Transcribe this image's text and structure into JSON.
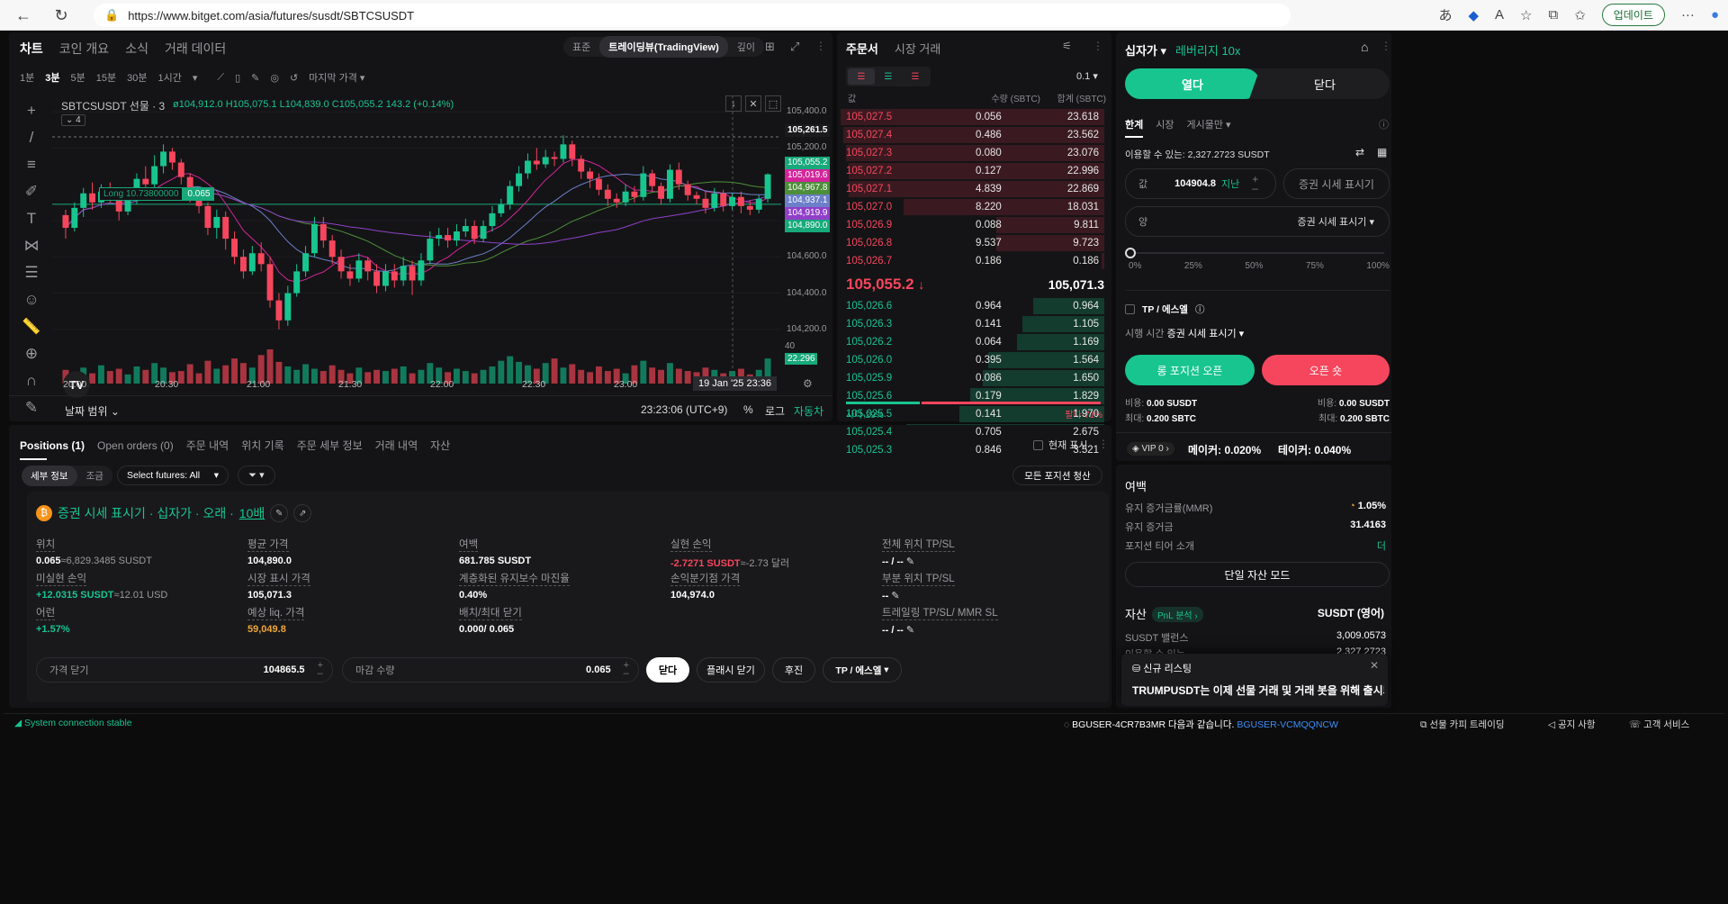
{
  "browser": {
    "url": "https://www.bitget.com/asia/futures/susdt/SBTCSUSDT",
    "update_label": "업데이트"
  },
  "chart_tabs": [
    "차트",
    "코인 개요",
    "소식",
    "거래 데이터"
  ],
  "view_modes": [
    "표준",
    "트레이딩뷰(TradingView)",
    "깊이"
  ],
  "intervals": [
    "1분",
    "3분",
    "5분",
    "15분",
    "30분",
    "1시간"
  ],
  "last_price_label": "마지막 가격",
  "chart_header": {
    "symbol": "SBTCSUSDT 선물 · 3",
    "ohlc": "ø104,912.0  H105,075.1  L104,839.0  C105,055.2  143.2 (+0.14%)",
    "indicator_count": "4"
  },
  "long_tag": {
    "label": "Long 10.73800000",
    "value": "0.065"
  },
  "price_axis": [
    "105,400.0",
    "105,200.0",
    "104,800.0",
    "104,600.0",
    "104,400.0",
    "104,200.0"
  ],
  "price_tags": [
    {
      "v": "105,261.5",
      "c": "#1b1b1d"
    },
    {
      "v": "105,055.2",
      "c": "#17a97a"
    },
    {
      "v": "105,019.6",
      "c": "#d3259b"
    },
    {
      "v": "104,967.8",
      "c": "#4d8e3a"
    },
    {
      "v": "104,937.1",
      "c": "#6c7fc9"
    },
    {
      "v": "104,919.9",
      "c": "#9040c8"
    },
    {
      "v": "104,890.0",
      "c": "#17a97a"
    }
  ],
  "volume_tags": {
    "top": "40",
    "value": "22.296"
  },
  "time_axis": [
    "20:00",
    "20:30",
    "21:00",
    "21:30",
    "22:00",
    "22:30",
    "23:00"
  ],
  "crosshair_time": "19 Jan '25  23:36",
  "chart_footer": {
    "range": "날짜 범위",
    "clock": "23:23:06 (UTC+9)",
    "pct": "%",
    "log": "로그",
    "auto": "자동차"
  },
  "chart_data": {
    "type": "candlestick",
    "title": "SBTCSUSDT 선물 · 3",
    "x_ticks": [
      "20:00",
      "20:30",
      "21:00",
      "21:30",
      "22:00",
      "22:30",
      "23:00"
    ],
    "ylim": [
      104100,
      105450
    ],
    "candles": [
      [
        104830,
        104760,
        104860,
        104700
      ],
      [
        104760,
        104870,
        104900,
        104740
      ],
      [
        104870,
        104950,
        104980,
        104820
      ],
      [
        104950,
        104900,
        105010,
        104860
      ],
      [
        104900,
        104960,
        105000,
        104870
      ],
      [
        104960,
        104940,
        105010,
        104900
      ],
      [
        104940,
        104850,
        104980,
        104800
      ],
      [
        104850,
        104920,
        104960,
        104830
      ],
      [
        104920,
        105030,
        105060,
        104890
      ],
      [
        105030,
        105000,
        105100,
        104960
      ],
      [
        105000,
        105100,
        105160,
        104980
      ],
      [
        105100,
        105180,
        105220,
        105060
      ],
      [
        105180,
        105120,
        105200,
        105080
      ],
      [
        105120,
        105040,
        105140,
        105000
      ],
      [
        105040,
        104940,
        105060,
        104900
      ],
      [
        104940,
        104880,
        104970,
        104840
      ],
      [
        104880,
        104760,
        104900,
        104720
      ],
      [
        104760,
        104820,
        104860,
        104700
      ],
      [
        104820,
        104700,
        104850,
        104640
      ],
      [
        104700,
        104600,
        104740,
        104560
      ],
      [
        104600,
        104520,
        104640,
        104480
      ],
      [
        104520,
        104620,
        104660,
        104500
      ],
      [
        104620,
        104560,
        104680,
        104520
      ],
      [
        104560,
        104360,
        104600,
        104320
      ],
      [
        104360,
        104250,
        104400,
        104200
      ],
      [
        104250,
        104400,
        104440,
        104220
      ],
      [
        104400,
        104520,
        104560,
        104380
      ],
      [
        104520,
        104620,
        104660,
        104490
      ],
      [
        104620,
        104780,
        104820,
        104600
      ],
      [
        104780,
        104690,
        104820,
        104650
      ],
      [
        104690,
        104600,
        104720,
        104560
      ],
      [
        104600,
        104520,
        104640,
        104480
      ],
      [
        104520,
        104480,
        104560,
        104440
      ],
      [
        104480,
        104580,
        104620,
        104460
      ],
      [
        104580,
        104520,
        104600,
        104470
      ],
      [
        104520,
        104440,
        104560,
        104400
      ],
      [
        104440,
        104520,
        104560,
        104410
      ],
      [
        104520,
        104470,
        104560,
        104430
      ],
      [
        104470,
        104550,
        104600,
        104440
      ],
      [
        104550,
        104470,
        104580,
        104390
      ],
      [
        104470,
        104580,
        104620,
        104440
      ],
      [
        104580,
        104700,
        104740,
        104560
      ],
      [
        104700,
        104720,
        104760,
        104660
      ],
      [
        104720,
        104690,
        104760,
        104650
      ],
      [
        104690,
        104740,
        104780,
        104660
      ],
      [
        104740,
        104770,
        104810,
        104710
      ],
      [
        104770,
        104700,
        104800,
        104670
      ],
      [
        104700,
        104770,
        104800,
        104680
      ],
      [
        104770,
        104840,
        104880,
        104740
      ],
      [
        104840,
        104890,
        104920,
        104820
      ],
      [
        104890,
        104990,
        105020,
        104860
      ],
      [
        104990,
        105060,
        105100,
        104960
      ],
      [
        105060,
        105130,
        105170,
        105030
      ],
      [
        105130,
        105110,
        105200,
        105080
      ],
      [
        105110,
        105150,
        105190,
        105090
      ],
      [
        105150,
        105140,
        105180,
        105100
      ],
      [
        105140,
        105220,
        105270,
        105120
      ],
      [
        105220,
        105140,
        105240,
        105100
      ],
      [
        105140,
        105070,
        105160,
        105030
      ],
      [
        105070,
        105030,
        105090,
        104980
      ],
      [
        105030,
        104970,
        105060,
        104940
      ],
      [
        104970,
        104920,
        105000,
        104880
      ],
      [
        104920,
        104900,
        104950,
        104870
      ],
      [
        104900,
        104960,
        105000,
        104880
      ],
      [
        104960,
        104930,
        104990,
        104900
      ],
      [
        104930,
        105060,
        105100,
        104910
      ],
      [
        105060,
        104990,
        105080,
        104960
      ],
      [
        104990,
        104920,
        105010,
        104890
      ],
      [
        104920,
        105080,
        105110,
        104900
      ],
      [
        105080,
        105000,
        105120,
        104970
      ],
      [
        105000,
        104940,
        105020,
        104910
      ],
      [
        104940,
        104920,
        104960,
        104890
      ],
      [
        104920,
        104870,
        104960,
        104840
      ],
      [
        104870,
        104950,
        104980,
        104850
      ],
      [
        104950,
        104880,
        104970,
        104850
      ],
      [
        104880,
        104930,
        104950,
        104860
      ],
      [
        104930,
        104880,
        104960,
        104840
      ],
      [
        104880,
        104860,
        104910,
        104830
      ],
      [
        104860,
        104920,
        104940,
        104840
      ],
      [
        104920,
        105055,
        105060,
        104900
      ]
    ],
    "volumes": [
      12,
      10,
      14,
      9,
      16,
      11,
      13,
      8,
      15,
      12,
      18,
      14,
      10,
      11,
      17,
      9,
      20,
      13,
      16,
      22,
      18,
      14,
      25,
      30,
      19,
      15,
      12,
      17,
      13,
      11,
      16,
      12,
      9,
      14,
      10,
      12,
      11,
      13,
      15,
      9,
      12,
      18,
      14,
      10,
      13,
      11,
      9,
      12,
      15,
      20,
      24,
      19,
      16,
      13,
      18,
      22,
      14,
      17,
      12,
      10,
      15,
      11,
      13,
      9,
      16,
      20,
      14,
      12,
      18,
      13,
      11,
      10,
      14,
      12,
      9,
      11,
      13,
      8,
      12,
      22
    ]
  },
  "orderbook": {
    "tabs": [
      "주문서",
      "시장 거래"
    ],
    "precision": "0.1",
    "headers": [
      "값",
      "수량 (SBTC)",
      "합계 (SBTC)"
    ],
    "asks": [
      {
        "p": "105,027.5",
        "q": "0.056",
        "t": "23.618",
        "d": 1.0
      },
      {
        "p": "105,027.4",
        "q": "0.486",
        "t": "23.562",
        "d": 0.99
      },
      {
        "p": "105,027.3",
        "q": "0.080",
        "t": "23.076",
        "d": 0.98
      },
      {
        "p": "105,027.2",
        "q": "0.127",
        "t": "22.996",
        "d": 0.97
      },
      {
        "p": "105,027.1",
        "q": "4.839",
        "t": "22.869",
        "d": 0.97
      },
      {
        "p": "105,027.0",
        "q": "8.220",
        "t": "18.031",
        "d": 0.76
      },
      {
        "p": "105,026.9",
        "q": "0.088",
        "t": "9.811",
        "d": 0.41
      },
      {
        "p": "105,026.8",
        "q": "9.537",
        "t": "9.723",
        "d": 0.41
      },
      {
        "p": "105,026.7",
        "q": "0.186",
        "t": "0.186",
        "d": 0.01
      }
    ],
    "mid_price": "105,055.2",
    "mark_price": "105,071.3",
    "bids": [
      {
        "p": "105,026.6",
        "q": "0.964",
        "t": "0.964",
        "d": 0.27
      },
      {
        "p": "105,026.3",
        "q": "0.141",
        "t": "1.105",
        "d": 0.31
      },
      {
        "p": "105,026.2",
        "q": "0.064",
        "t": "1.169",
        "d": 0.33
      },
      {
        "p": "105,026.0",
        "q": "0.395",
        "t": "1.564",
        "d": 0.44
      },
      {
        "p": "105,025.9",
        "q": "0.086",
        "t": "1.650",
        "d": 0.46
      },
      {
        "p": "105,025.6",
        "q": "0.179",
        "t": "1.829",
        "d": 0.51
      },
      {
        "p": "105,025.5",
        "q": "0.141",
        "t": "1.970",
        "d": 0.55
      },
      {
        "p": "105,025.4",
        "q": "0.705",
        "t": "2.675",
        "d": 0.75
      },
      {
        "p": "105,025.3",
        "q": "0.846",
        "t": "3.521",
        "d": 0.98
      }
    ],
    "buy_ratio": "사다-29%",
    "sell_ratio": "팔다-71%",
    "buy_fraction": 0.29
  },
  "trade": {
    "mode": "십자가",
    "leverage": "레버리지 10x",
    "open": "열다",
    "close": "닫다",
    "order_types": [
      "한계",
      "시장",
      "게시물만"
    ],
    "available": "이용할 수 있는: 2,327.2723 SUSDT",
    "price_label": "값",
    "price_value": "104904.8",
    "price_unit": "지난",
    "mark_btn": "증권 시세 표시기",
    "amount_label": "양",
    "amount_unit": "증권 시세 표시기",
    "slider": [
      "0%",
      "25%",
      "50%",
      "75%",
      "100%"
    ],
    "tpsl": "TP / 에스엘",
    "exec_label": "시행 시간",
    "exec_value": "증권 시세 표시기",
    "long_btn": "롱 포지션 오픈",
    "short_btn": "오픈 숏",
    "cost_label": "비용:",
    "cost_long": "0.00 SUSDT",
    "cost_short": "0.00 SUSDT",
    "max_label": "최대:",
    "max_long": "0.200 SBTC",
    "max_short": "0.200 SBTC",
    "vip": "VIP 0",
    "maker": "메이커: 0.020%",
    "taker": "테이커: 0.040%"
  },
  "margin": {
    "title": "여백",
    "rows": [
      {
        "l": "유지 증거금률(MMR)",
        "v": "1.05%"
      },
      {
        "l": "유지 증거금",
        "v": "31.4163"
      },
      {
        "l": "포지션 티어 소개",
        "v": "더"
      }
    ],
    "single_mode": "단일 자산 모드",
    "assets_title": "자산",
    "pnl": "PnL 분석",
    "asset_unit": "SUSDT (영어)",
    "asset_rows": [
      {
        "l": "SUSDT 밸런스",
        "v": "3,009.0573"
      },
      {
        "l": "이용할 수 있는",
        "v": "2,327.2723"
      }
    ]
  },
  "notice": {
    "title": "신규 리스팅",
    "body": "TRUMPUSDT는 이제 선물 거래 및 거래 봇을 위해 출시되"
  },
  "positions": {
    "tabs": [
      "Positions (1)",
      "Open orders (0)",
      "주문 내역",
      "위치 기록",
      "주문 세부 정보",
      "거래 내역",
      "자산"
    ],
    "show_current": "현재 표시",
    "subtabs": [
      "세부 정보",
      "조금"
    ],
    "select_futures": "Select futures: All",
    "close_all": "모든 포지션 청산",
    "title": "증권 시세 표시기 · 십자가 · 오래 · ",
    "leverage": "10배",
    "cells": [
      {
        "l": "위치",
        "v": "0.065",
        "s": "≈6,829.3485 SUSDT",
        "c": "#fff"
      },
      {
        "l": "평균 가격",
        "v": "104,890.0",
        "s": "",
        "c": "#fff"
      },
      {
        "l": "여백",
        "v": "681.785 SUSDT",
        "s": "",
        "c": "#fff"
      },
      {
        "l": "실현 손익",
        "v": "-2.7271 SUSDT",
        "s": "≈-2.73 달러",
        "c": "#f6465d"
      },
      {
        "l": "전체 위치 TP/SL",
        "v": "-- / --",
        "s": "",
        "c": "#fff"
      },
      {
        "l": "미실현 손익",
        "v": "+12.0315 SUSDT",
        "s": "≈12.01 USD",
        "c": "#18c58f"
      },
      {
        "l": "시장 표시 가격",
        "v": "105,071.3",
        "s": "",
        "c": "#fff"
      },
      {
        "l": "계층화된 유지보수 마진율",
        "v": "0.40%",
        "s": "",
        "c": "#fff"
      },
      {
        "l": "손익분기점 가격",
        "v": "104,974.0",
        "s": "",
        "c": "#fff"
      },
      {
        "l": "부분 위치 TP/SL",
        "v": "--",
        "s": "",
        "c": "#fff"
      },
      {
        "l": "어런",
        "v": "+1.57%",
        "s": "",
        "c": "#18c58f"
      },
      {
        "l": "예상 liq. 가격",
        "v": "59,049.8",
        "s": "",
        "c": "#f0a63a"
      },
      {
        "l": "배치/최대 닫기",
        "v": "0.000/ 0.065",
        "s": "",
        "c": "#fff"
      },
      {
        "l": "",
        "v": "",
        "s": "",
        "c": "#fff"
      },
      {
        "l": "트레일링 TP/SL/ MMR SL",
        "v": "-- / --",
        "s": "",
        "c": "#fff"
      }
    ],
    "close_price_label": "가격 닫기",
    "close_price": "104865.5",
    "close_qty_label": "마감 수량",
    "close_qty": "0.065",
    "close_btn": "닫다",
    "flash_close": "플래시 닫기",
    "reverse": "후진",
    "tpsl": "TP / 에스엘"
  },
  "status": {
    "conn": "System connection stable",
    "ref": "BGUSER-4CR7B3MR 다음과 같습니다.",
    "ref_link": "BGUSER-VCMQQNCW",
    "copy": "선물 카피 트레이딩",
    "notice": "공지 사항",
    "support": "고객 서비스"
  }
}
